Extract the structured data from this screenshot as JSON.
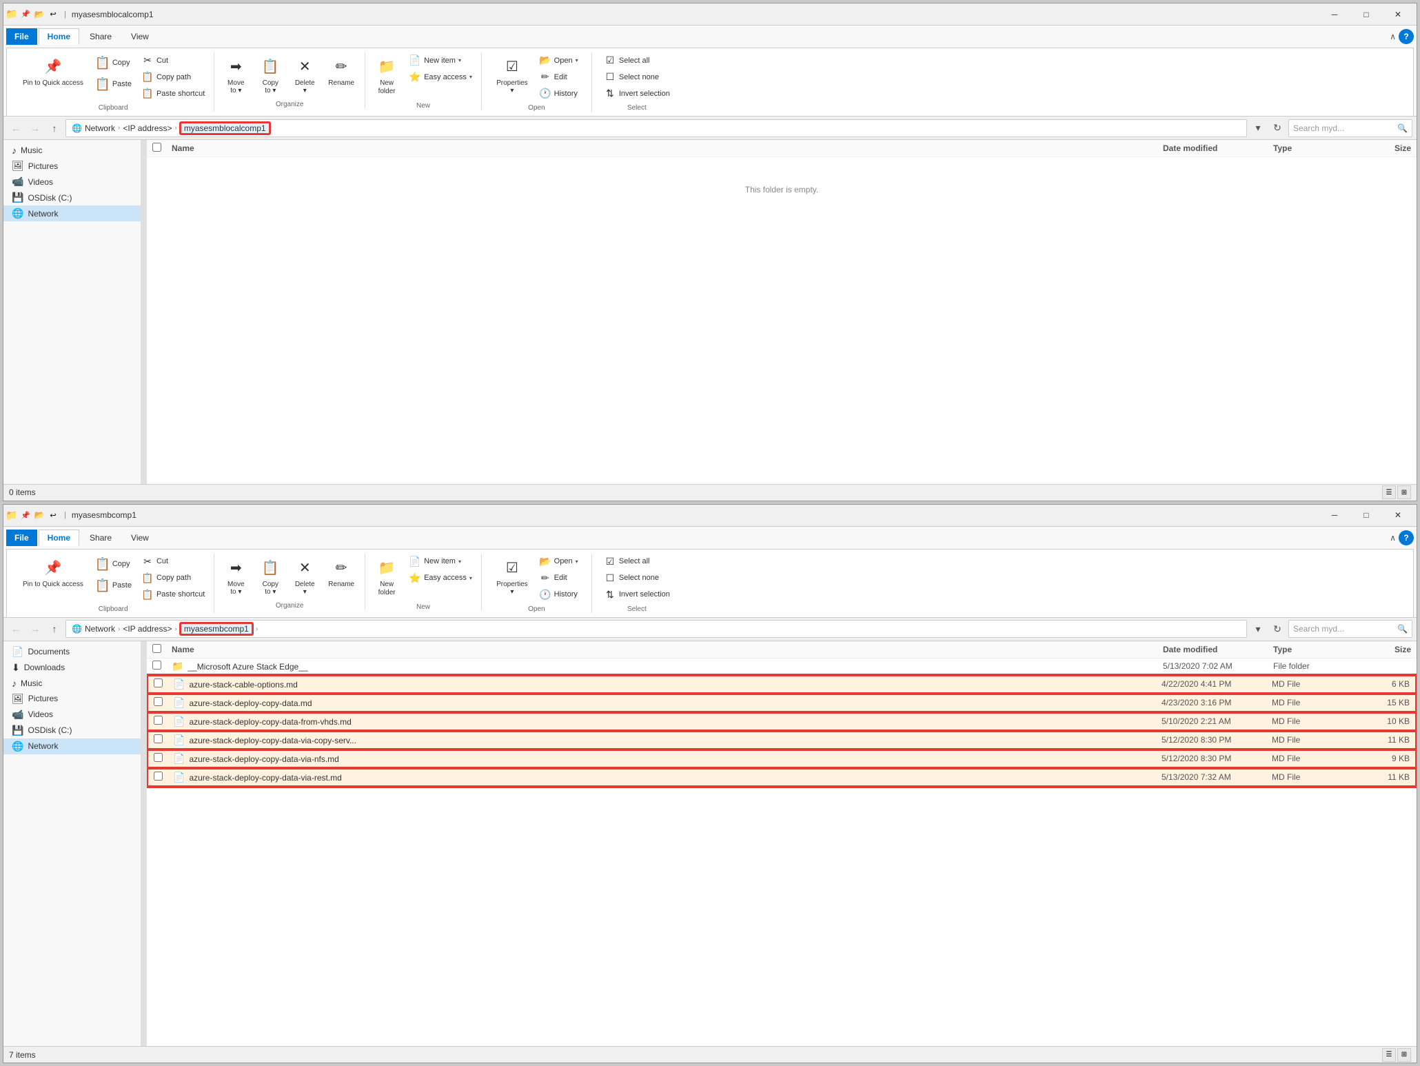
{
  "window1": {
    "title": "myasesmblocalcomp1",
    "tabs": {
      "file": "File",
      "home": "Home",
      "share": "Share",
      "view": "View"
    },
    "ribbon": {
      "groups": {
        "clipboard": {
          "label": "Clipboard",
          "pin_label": "Pin to Quick\naccess",
          "copy_label": "Copy",
          "paste_label": "Paste",
          "cut_label": "Cut",
          "copy_path_label": "Copy path",
          "paste_shortcut_label": "Paste shortcut"
        },
        "organize": {
          "label": "Organize",
          "move_to_label": "Move\nto",
          "copy_to_label": "Copy\nto",
          "delete_label": "Delete",
          "rename_label": "Rename"
        },
        "new": {
          "label": "New",
          "new_folder_label": "New\nfolder",
          "new_item_label": "New item",
          "easy_access_label": "Easy access"
        },
        "open": {
          "label": "Open",
          "open_label": "Open",
          "edit_label": "Edit",
          "history_label": "History",
          "properties_label": "Properties"
        },
        "select": {
          "label": "Select",
          "select_all_label": "Select all",
          "select_none_label": "Select none",
          "invert_label": "Invert selection"
        }
      }
    },
    "address": {
      "path_parts": [
        "Network",
        "<IP address>",
        "myasesmblocalcomp1"
      ],
      "search_placeholder": "Search myd..."
    },
    "sidebar": {
      "items": [
        {
          "label": "Music",
          "icon": "♪"
        },
        {
          "label": "Pictures",
          "icon": "🖼"
        },
        {
          "label": "Videos",
          "icon": "📹"
        },
        {
          "label": "OSDisk (C:)",
          "icon": "💾"
        },
        {
          "label": "Network",
          "icon": "🌐"
        }
      ]
    },
    "file_list": {
      "columns": [
        "Name",
        "Date modified",
        "Type",
        "Size"
      ],
      "empty_text": "This folder is empty.",
      "items": []
    },
    "status": {
      "count": "0 items"
    }
  },
  "window2": {
    "title": "myasesmbcomp1",
    "tabs": {
      "file": "File",
      "home": "Home",
      "share": "Share",
      "view": "View"
    },
    "ribbon": {
      "groups": {
        "clipboard": {
          "label": "Clipboard",
          "pin_label": "Pin to Quick\naccess",
          "copy_label": "Copy",
          "paste_label": "Paste",
          "cut_label": "Cut",
          "copy_path_label": "Copy path",
          "paste_shortcut_label": "Paste shortcut"
        },
        "organize": {
          "label": "Organize",
          "move_to_label": "Move\nto",
          "copy_to_label": "Copy\nto",
          "delete_label": "Delete",
          "rename_label": "Rename"
        },
        "new": {
          "label": "New",
          "new_folder_label": "New\nfolder",
          "new_item_label": "New item",
          "easy_access_label": "Easy access"
        },
        "open": {
          "label": "Open",
          "open_label": "Open",
          "edit_label": "Edit",
          "history_label": "History",
          "properties_label": "Properties"
        },
        "select": {
          "label": "Select",
          "select_all_label": "Select all",
          "select_none_label": "Select none",
          "invert_label": "Invert selection"
        }
      }
    },
    "address": {
      "path_parts": [
        "Network",
        "<IP address>",
        "myasesmbcomp1"
      ],
      "search_placeholder": "Search myd..."
    },
    "sidebar": {
      "items": [
        {
          "label": "Documents",
          "icon": "📄"
        },
        {
          "label": "Downloads",
          "icon": "⬇"
        },
        {
          "label": "Music",
          "icon": "♪"
        },
        {
          "label": "Pictures",
          "icon": "🖼"
        },
        {
          "label": "Videos",
          "icon": "📹"
        },
        {
          "label": "OSDisk (C:)",
          "icon": "💾"
        },
        {
          "label": "Network",
          "icon": "🌐"
        }
      ]
    },
    "file_list": {
      "columns": [
        "Name",
        "Date modified",
        "Type",
        "Size"
      ],
      "items": [
        {
          "name": "__Microsoft Azure Stack Edge__",
          "date": "5/13/2020 7:02 AM",
          "type": "File folder",
          "size": "",
          "icon": "📁",
          "highlighted": false
        },
        {
          "name": "azure-stack-cable-options.md",
          "date": "4/22/2020 4:41 PM",
          "type": "MD File",
          "size": "6 KB",
          "icon": "📄",
          "highlighted": true
        },
        {
          "name": "azure-stack-deploy-copy-data.md",
          "date": "4/23/2020 3:16 PM",
          "type": "MD File",
          "size": "15 KB",
          "icon": "📄",
          "highlighted": true
        },
        {
          "name": "azure-stack-deploy-copy-data-from-vhds.md",
          "date": "5/10/2020 2:21 AM",
          "type": "MD File",
          "size": "10 KB",
          "icon": "📄",
          "highlighted": true
        },
        {
          "name": "azure-stack-deploy-copy-data-via-copy-serv...",
          "date": "5/12/2020 8:30 PM",
          "type": "MD File",
          "size": "11 KB",
          "icon": "📄",
          "highlighted": true
        },
        {
          "name": "azure-stack-deploy-copy-data-via-nfs.md",
          "date": "5/12/2020 8:30 PM",
          "type": "MD File",
          "size": "9 KB",
          "icon": "📄",
          "highlighted": true
        },
        {
          "name": "azure-stack-deploy-copy-data-via-rest.md",
          "date": "5/13/2020 7:32 AM",
          "type": "MD File",
          "size": "11 KB",
          "icon": "📄",
          "highlighted": true
        }
      ]
    },
    "status": {
      "count": "7 items"
    }
  },
  "icons": {
    "back": "←",
    "forward": "→",
    "up": "↑",
    "refresh": "↻",
    "search": "🔍",
    "minimize": "─",
    "maximize": "□",
    "close": "✕",
    "collapse": "∧",
    "help": "?",
    "chevron_down": "▾",
    "chevron_right": "›"
  }
}
